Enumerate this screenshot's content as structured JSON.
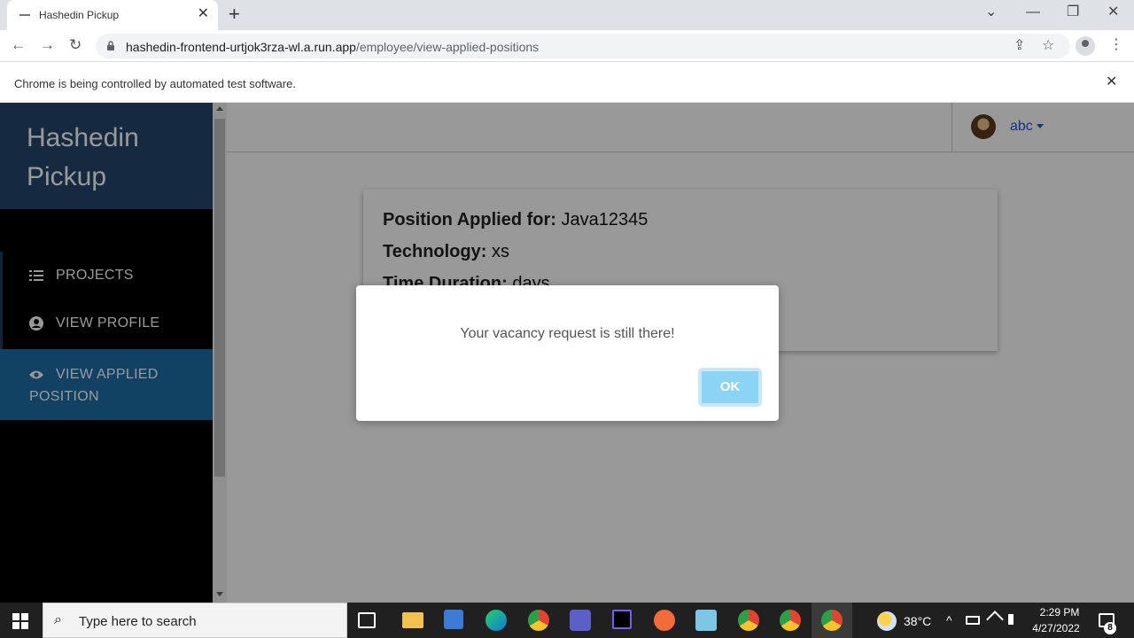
{
  "browser": {
    "tab_title": "Hashedin Pickup",
    "tab_close": "✕",
    "new_tab": "+",
    "url_host": "hashedin-frontend-urtjok3rza-wl.a.run.app",
    "url_path": "/employee/view-applied-positions",
    "infobar_message": "Chrome is being controlled by automated test software.",
    "infobar_close": "✕",
    "back": "←",
    "forward": "→",
    "reload": "↻",
    "share": "⇪",
    "star": "☆",
    "menu": "⋮",
    "minimize": "—",
    "maximize": "❐",
    "close": "✕",
    "tab_search": "⌄"
  },
  "sidebar": {
    "brand_line1": "Hashedin",
    "brand_line2": "Pickup",
    "brand_color": "#23476b",
    "active_color": "#1e6ea6",
    "items": [
      {
        "label": "PROJECTS",
        "icon": "list-icon"
      },
      {
        "label": "VIEW PROFILE",
        "icon": "user-circle-icon"
      },
      {
        "label": "VIEW APPLIED POSITION",
        "icon": "eye-icon",
        "active": true
      }
    ]
  },
  "header": {
    "user_name": "abc"
  },
  "position_card": {
    "position_label": "Position Applied for:",
    "position_value": "Java12345",
    "technology_label": "Technology:",
    "technology_value": "xs",
    "duration_label": "Time Duration:",
    "duration_value": "days"
  },
  "modal": {
    "message": "Your vacancy request is still there!",
    "ok_label": "OK",
    "ok_color": "#8cd4f5"
  },
  "taskbar": {
    "search_placeholder": "Type here to search",
    "search_icon": "⌕",
    "weather_temp": "38°C",
    "time": "2:29 PM",
    "date": "4/27/2022",
    "tray_chevron": "^",
    "notification_count": "8"
  }
}
